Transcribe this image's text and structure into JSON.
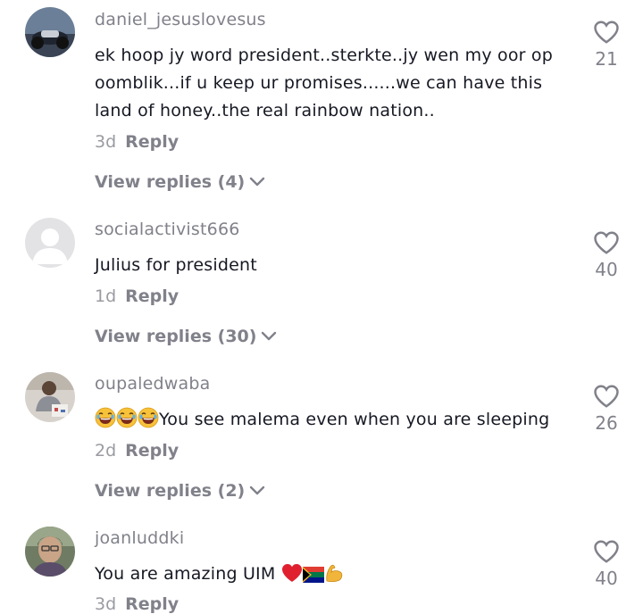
{
  "comments": [
    {
      "username": "daniel_jesuslovesus",
      "text": "ek hoop jy word president..sterkte..jy wen my oor op oomblik...if u keep ur promises......we can have this land of honey..the real rainbow nation..",
      "time": "3d",
      "reply_label": "Reply",
      "view_replies": "View replies (4)",
      "likes": "21",
      "avatar": "motorcycle-photo"
    },
    {
      "username": "socialactivist666",
      "text": "Julius for president",
      "time": "1d",
      "reply_label": "Reply",
      "view_replies": "View replies (30)",
      "likes": "40",
      "avatar": "default-avatar"
    },
    {
      "username": "oupaledwaba",
      "text_prefix_emojis": [
        "face-with-tears-of-joy",
        "face-with-tears-of-joy",
        "face-with-tears-of-joy"
      ],
      "text": "You see malema even when you are sleeping",
      "time": "2d",
      "reply_label": "Reply",
      "view_replies": "View replies (2)",
      "likes": "26",
      "avatar": "person-photo"
    },
    {
      "username": "joanluddki",
      "text": "You are amazing UIM",
      "text_suffix_emojis": [
        "red-heart",
        "south-africa-flag",
        "flexed-biceps"
      ],
      "time": "3d",
      "reply_label": "Reply",
      "likes": "40",
      "avatar": "woman-photo"
    }
  ],
  "colors": {
    "primary_text": "#161823",
    "secondary_text": "#80818a",
    "muted_text": "#9a9ba2"
  }
}
